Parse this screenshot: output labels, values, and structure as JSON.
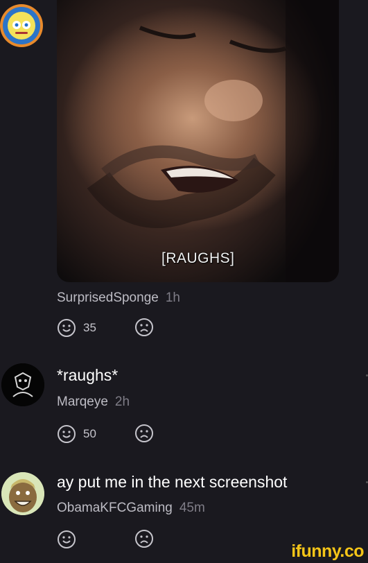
{
  "post": {
    "image_caption": "[RAUGHS]"
  },
  "comments": [
    {
      "author": "SurprisedSponge",
      "time": "1h",
      "smile_count": "35"
    },
    {
      "text": "*raughs*",
      "author": "Marqeye",
      "time": "2h",
      "smile_count": "50"
    },
    {
      "text": "ay put me in the next screenshot",
      "author": "ObamaKFCGaming",
      "time": "45m",
      "smile_count": ""
    }
  ],
  "watermark": "ifunny.co",
  "colors": {
    "background": "#1a191f",
    "accent": "#f5c518",
    "meta_text": "#bdbcc4",
    "time_text": "#7f7d87"
  },
  "icons": [
    "smile-icon",
    "frown-icon"
  ]
}
